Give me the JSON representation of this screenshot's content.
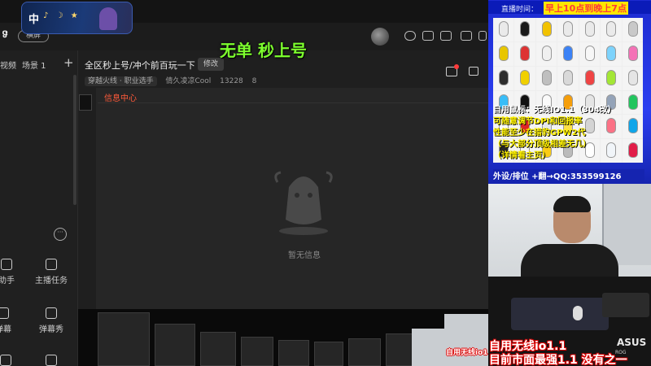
{
  "ime": {
    "lang": "中",
    "glyphs": "♪ ☽ ★"
  },
  "overlay": {
    "title": "无单 秒上号"
  },
  "header": {
    "logo": "ទ",
    "mode_pill": "横屏"
  },
  "sidebar": {
    "tabs": [
      "视频",
      "场景 1"
    ],
    "add_label": "+",
    "more_label": "···",
    "tools": [
      {
        "label": "助手",
        "icon": "assistant-icon"
      },
      {
        "label": "主播任务",
        "icon": "task-icon"
      },
      {
        "label": "弹幕",
        "icon": "danmaku-icon"
      },
      {
        "label": "弹幕秀",
        "icon": "danmaku-show-icon"
      }
    ]
  },
  "room": {
    "title": "全区秒上号/冲个前百玩一下",
    "edit_label": "修改",
    "category": "穿越火线 · 职业选手",
    "streamer": "倩久凌凉Cool",
    "room_id": "13228",
    "heat": "8"
  },
  "panel": {
    "tab_label": "信息中心",
    "empty_text": "暂无信息"
  },
  "ad": {
    "time_label": "直播时间：",
    "time_value": "早上10点到晚上7点",
    "line1": "自用鼠标：无线IO1.1（304改）",
    "line2": "可随意调节DPI和回报率",
    "line3": "性能至少在猎豹GPW2代",
    "line4": "（与大部分顶级相差无几）",
    "line5": "（详情看主页）",
    "contact": "外设/排位    +翻→QQ:353599126",
    "mouse_colors": [
      "#eaeaea",
      "#1a1a1a",
      "#f2c200",
      "#eaeaea",
      "#eaeaea",
      "#eaeaea",
      "#c9c9c9",
      "#e8c600",
      "#d33",
      "#f0f0f0",
      "#3b82f6",
      "#f7f7f7",
      "#7dd3fc",
      "#f472b6",
      "#2d2d2d",
      "#f0d000",
      "#bfbfbf",
      "#d9d9d9",
      "#ef4444",
      "#a3e635",
      "#e5e5e5",
      "#38bdf8",
      "#111",
      "#fafafa",
      "#f59e0b",
      "#e5e5e5",
      "#94a3b8",
      "#22c55e",
      "#f9f9f9",
      "#dc2626",
      "#e5e7eb",
      "#fde047",
      "#d4d4d4",
      "#fb7185",
      "#0ea5e9",
      "#262626",
      "#f5f5f5",
      "#facc15",
      "#bbbbbb",
      "#ffffff",
      "#f1f5f9",
      "#e11d48"
    ]
  },
  "cam": {
    "logo": "ASUS",
    "logo_sub": "ROG"
  },
  "captions": {
    "line1": "自用无线io1.1",
    "line2": "目前市面最强1.1 没有之一"
  }
}
